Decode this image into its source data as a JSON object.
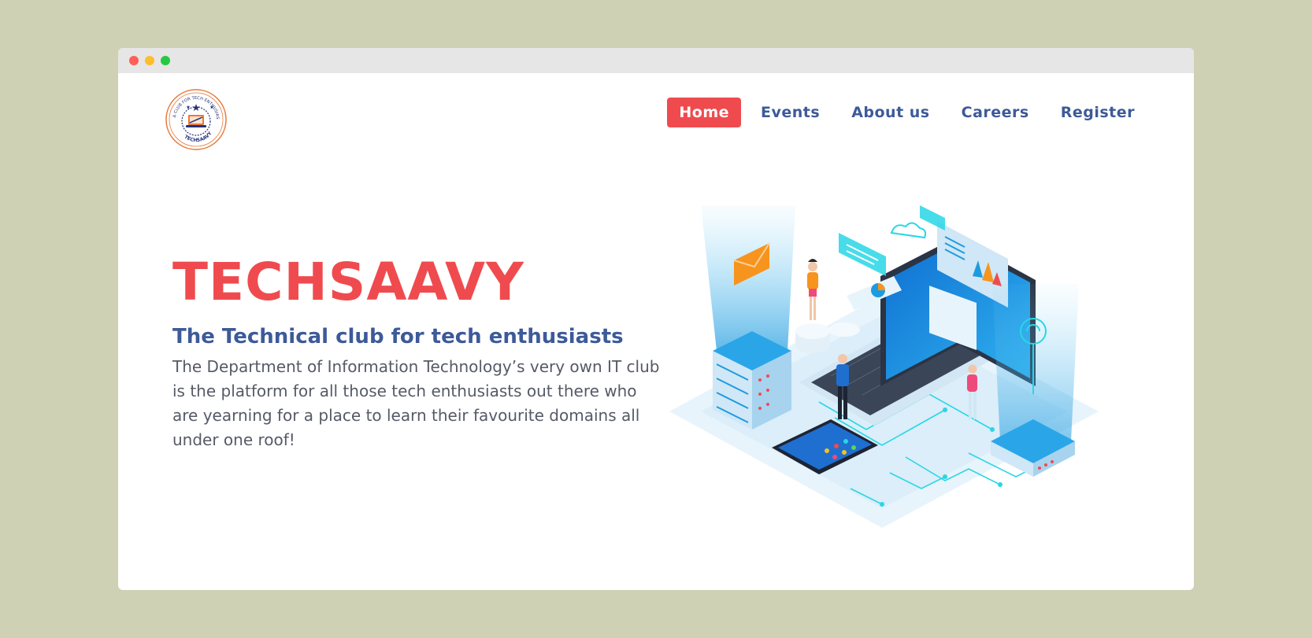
{
  "window": {
    "controls": [
      "close",
      "minimize",
      "maximize"
    ]
  },
  "logo": {
    "ring_text": "A CLUB FOR TECH ENTHUSIASTS",
    "name": "TECHSAAVY",
    "icon": "club-emblem-icon"
  },
  "nav": {
    "items": [
      {
        "label": "Home",
        "active": true
      },
      {
        "label": "Events",
        "active": false
      },
      {
        "label": "About us",
        "active": false
      },
      {
        "label": "Careers",
        "active": false
      },
      {
        "label": "Register",
        "active": false
      }
    ]
  },
  "hero": {
    "title": "TECHSAAVY",
    "tagline": "The Technical club for tech enthusiasts",
    "description": "The Department of Information Technology’s very own IT club is the platform for all those tech enthusiasts out there who are yearning for a place to learn their favourite domains all under one roof!",
    "illustration_icon": "isometric-tech-illustration-icon"
  },
  "colors": {
    "page_background": "#cfd1b5",
    "accent": "#ef4b4f",
    "nav_text": "#3d5a99",
    "tagline": "#3d5a99",
    "body_text": "#555a66"
  }
}
